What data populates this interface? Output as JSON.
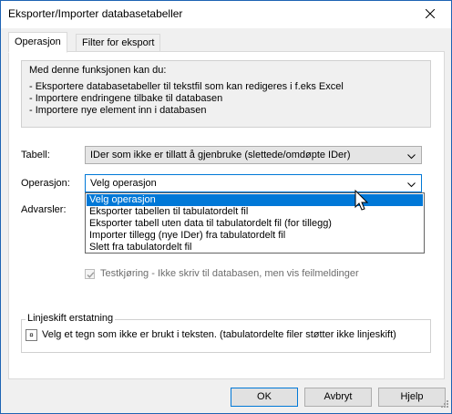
{
  "window": {
    "title": "Eksporter/Importer databasetabeller"
  },
  "tabs": [
    {
      "label": "Operasjon"
    },
    {
      "label": "Filter for eksport"
    }
  ],
  "intro": {
    "heading": "Med denne funksjonen kan du:",
    "lines": [
      "- Eksportere databasetabeller til tekstfil som kan redigeres i f.eks Excel",
      "- Importere endringene tilbake til databasen",
      "- Importere nye element inn i databasen"
    ]
  },
  "tabell": {
    "label": "Tabell:",
    "value": "IDer som ikke er tillatt å gjenbruke (slettede/omdøpte IDer)"
  },
  "operasjon": {
    "label": "Operasjon:",
    "value": "Velg operasjon",
    "options": [
      "Velg operasjon",
      "Eksporter tabellen til tabulatordelt fil",
      "Eksporter tabell uten data til tabulatordelt fil (for tillegg)",
      "Importer tillegg (nye IDer) fra tabulatordelt fil",
      "Slett fra tabulatordelt fil"
    ],
    "selected_index": 0
  },
  "advarsler": {
    "label": "Advarsler:"
  },
  "testkjoring": {
    "label": "Testkjøring - Ikke skriv til databasen, men vis feilmeldinger",
    "checked": true,
    "enabled": false
  },
  "linjeskift": {
    "title": "Linjeskift erstatning",
    "char": "¤",
    "text": "Velg et tegn som ikke er brukt i teksten.  (tabulatordelte filer støtter ikke linjeskift)"
  },
  "buttons": {
    "ok": "OK",
    "cancel": "Avbryt",
    "help": "Hjelp"
  },
  "colors": {
    "accent": "#0078d7",
    "window_border": "#1e64b4"
  }
}
